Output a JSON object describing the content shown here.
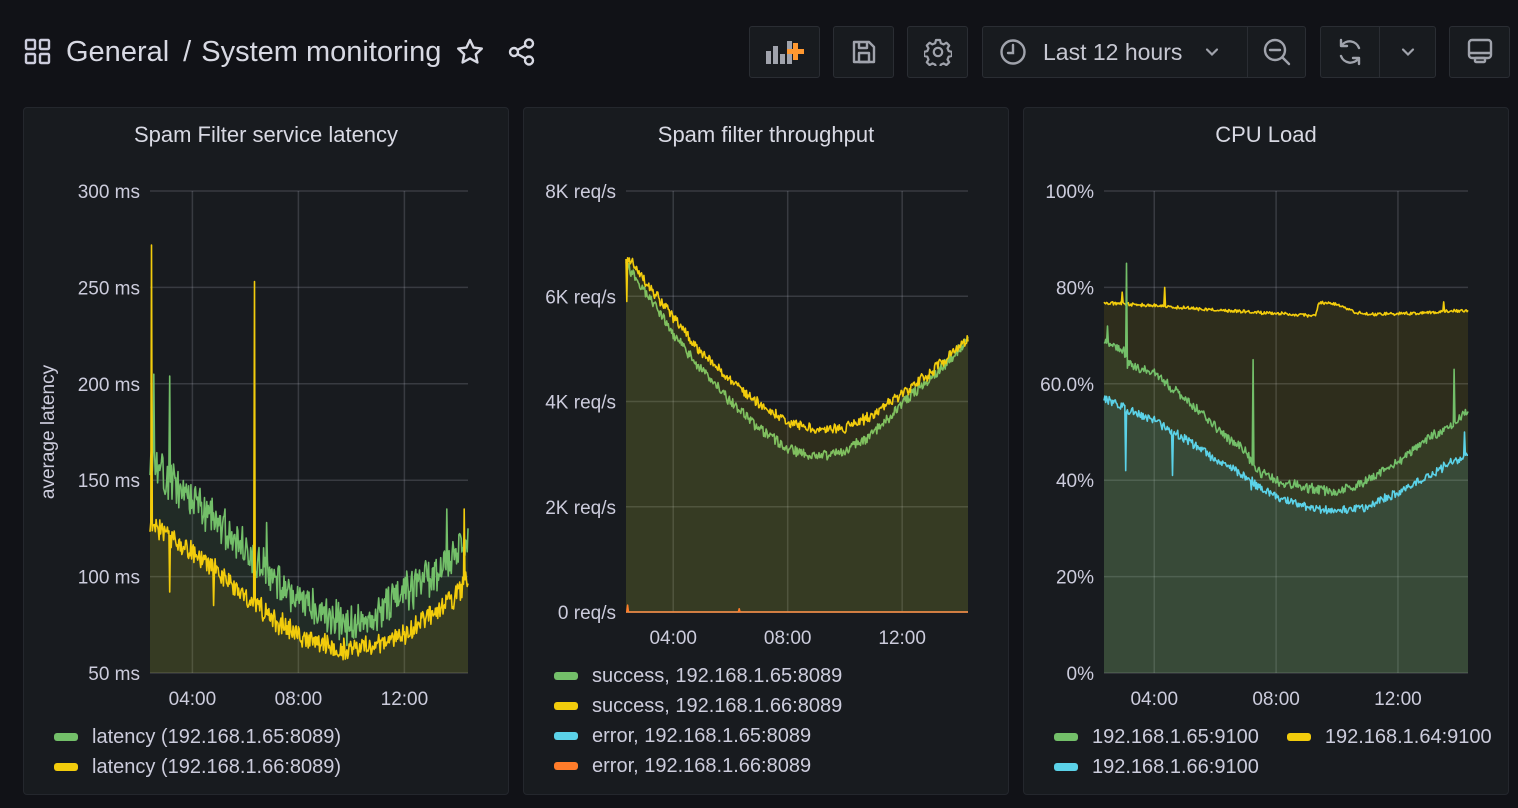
{
  "header": {
    "breadcrumb_root": "General",
    "breadcrumb_separator": "/",
    "dashboard_title": "System monitoring",
    "icons": [
      "dashboard-grid-icon",
      "star-icon",
      "share-icon"
    ]
  },
  "toolbar": {
    "add_panel_icon": "add-panel-icon",
    "save_icon": "save-icon",
    "settings_icon": "gear-icon",
    "time_range_label": "Last 12 hours",
    "time_icon": "clock-icon",
    "zoom_out_icon": "zoom-out-icon",
    "refresh_icon": "refresh-icon",
    "refresh_dropdown_icon": "chevron-down-icon",
    "view_mode_icon": "monitor-icon",
    "accent_color": "#ff9830"
  },
  "colors": {
    "green": "#73bf69",
    "yellow": "#f2cc0c",
    "blue": "#5bd2e8",
    "orange": "#ff7c2a",
    "background": "#111217",
    "panel": "#181b1f"
  },
  "panels": [
    {
      "title": "Spam Filter service latency",
      "legend": [
        {
          "label": "latency (192.168.1.65:8089)",
          "color": "#73bf69"
        },
        {
          "label": "latency (192.168.1.66:8089)",
          "color": "#f2cc0c"
        }
      ]
    },
    {
      "title": "Spam filter throughput",
      "legend": [
        {
          "label": "success, 192.168.1.65:8089",
          "color": "#73bf69"
        },
        {
          "label": "success, 192.168.1.66:8089",
          "color": "#f2cc0c"
        },
        {
          "label": "error, 192.168.1.65:8089",
          "color": "#5bd2e8"
        },
        {
          "label": "error, 192.168.1.66:8089",
          "color": "#ff7c2a"
        }
      ]
    },
    {
      "title": "CPU Load",
      "legend": [
        {
          "label": "192.168.1.65:9100",
          "color": "#73bf69"
        },
        {
          "label": "192.168.1.64:9100",
          "color": "#f2cc0c"
        },
        {
          "label": "192.168.1.66:9100",
          "color": "#5bd2e8"
        }
      ]
    }
  ],
  "chart_data": [
    {
      "type": "area",
      "title": "Spam Filter service latency",
      "xlabel": "",
      "ylabel": "average latency",
      "x_range_hours": [
        2.4,
        14.4
      ],
      "x_ticks": [
        {
          "value": 4,
          "label": "04:00"
        },
        {
          "value": 8,
          "label": "08:00"
        },
        {
          "value": 12,
          "label": "12:00"
        }
      ],
      "ylim": [
        50,
        300
      ],
      "y_ticks": [
        {
          "value": 50,
          "label": "50 ms"
        },
        {
          "value": 100,
          "label": "100 ms"
        },
        {
          "value": 150,
          "label": "150 ms"
        },
        {
          "value": 200,
          "label": "200 ms"
        },
        {
          "value": 250,
          "label": "250 ms"
        },
        {
          "value": 300,
          "label": "300 ms"
        }
      ],
      "grid": true,
      "legend_position": "bottom",
      "series": [
        {
          "name": "latency (192.168.1.65:8089)",
          "color": "#73bf69",
          "noise": 9,
          "seed": 11,
          "x": [
            2.4,
            3.0,
            4.0,
            5.0,
            6.0,
            7.0,
            8.0,
            9.0,
            10.0,
            11.0,
            12.0,
            13.0,
            14.0,
            14.4
          ],
          "values": [
            160,
            150,
            140,
            128,
            115,
            100,
            88,
            80,
            74,
            80,
            92,
            100,
            112,
            120
          ],
          "spikes": [
            {
              "x": 2.55,
              "value": 205
            },
            {
              "x": 3.15,
              "value": 204
            },
            {
              "x": 6.8,
              "value": 128
            },
            {
              "x": 13.6,
              "value": 135
            }
          ]
        },
        {
          "name": "latency (192.168.1.66:8089)",
          "color": "#f2cc0c",
          "noise": 5,
          "seed": 23,
          "x": [
            2.4,
            3.0,
            4.0,
            5.0,
            6.0,
            7.0,
            8.0,
            9.0,
            10.0,
            11.0,
            12.0,
            13.0,
            14.0,
            14.4
          ],
          "values": [
            128,
            122,
            113,
            102,
            90,
            78,
            70,
            65,
            62,
            64,
            70,
            80,
            90,
            100
          ],
          "spikes": [
            {
              "x": 2.45,
              "value": 272
            },
            {
              "x": 6.35,
              "value": 253
            },
            {
              "x": 3.15,
              "value": 92
            },
            {
              "x": 4.8,
              "value": 85
            },
            {
              "x": 14.25,
              "value": 135
            }
          ]
        }
      ]
    },
    {
      "type": "area",
      "title": "Spam filter throughput",
      "xlabel": "",
      "ylabel": "",
      "x_range_hours": [
        2.35,
        14.3
      ],
      "x_ticks": [
        {
          "value": 4,
          "label": "04:00"
        },
        {
          "value": 8,
          "label": "08:00"
        },
        {
          "value": 12,
          "label": "12:00"
        }
      ],
      "ylim": [
        0,
        8000
      ],
      "y_ticks": [
        {
          "value": 0,
          "label": "0 req/s"
        },
        {
          "value": 2000,
          "label": "2K req/s"
        },
        {
          "value": 4000,
          "label": "4K req/s"
        },
        {
          "value": 6000,
          "label": "6K req/s"
        },
        {
          "value": 8000,
          "label": "8K req/s"
        }
      ],
      "grid": true,
      "legend_position": "bottom",
      "series": [
        {
          "name": "success, 192.168.1.65:8089",
          "color": "#73bf69",
          "noise": 90,
          "seed": 5,
          "x": [
            2.35,
            3.0,
            4.0,
            5.0,
            6.0,
            7.0,
            8.0,
            9.0,
            10.0,
            11.0,
            12.0,
            13.0,
            14.3
          ],
          "values": [
            6600,
            6100,
            5300,
            4600,
            4000,
            3500,
            3100,
            2950,
            3050,
            3400,
            3950,
            4450,
            5150
          ],
          "spikes": []
        },
        {
          "name": "success, 192.168.1.66:8089",
          "color": "#f2cc0c",
          "noise": 90,
          "seed": 9,
          "x": [
            2.35,
            3.0,
            4.0,
            5.0,
            6.0,
            7.0,
            8.0,
            9.0,
            10.0,
            11.0,
            12.0,
            13.0,
            14.3
          ],
          "values": [
            6800,
            6300,
            5600,
            4900,
            4400,
            3950,
            3600,
            3450,
            3500,
            3750,
            4150,
            4550,
            5200
          ],
          "spikes": [
            {
              "x": 2.38,
              "value": 5900
            }
          ]
        },
        {
          "name": "error, 192.168.1.65:8089",
          "color": "#5bd2e8",
          "noise": 0,
          "seed": 1,
          "x": [
            2.35,
            14.3
          ],
          "values": [
            0,
            0
          ],
          "spikes": []
        },
        {
          "name": "error, 192.168.1.66:8089",
          "color": "#ff7c2a",
          "noise": 0,
          "seed": 2,
          "x": [
            2.35,
            14.3
          ],
          "values": [
            0,
            0
          ],
          "spikes": [
            {
              "x": 2.4,
              "value": 130
            },
            {
              "x": 6.3,
              "value": 60
            }
          ]
        }
      ]
    },
    {
      "type": "area",
      "title": "CPU Load",
      "xlabel": "",
      "ylabel": "",
      "x_range_hours": [
        2.35,
        14.3
      ],
      "x_ticks": [
        {
          "value": 4,
          "label": "04:00"
        },
        {
          "value": 8,
          "label": "08:00"
        },
        {
          "value": 12,
          "label": "12:00"
        }
      ],
      "ylim": [
        0,
        100
      ],
      "y_ticks": [
        {
          "value": 0,
          "label": "0%"
        },
        {
          "value": 20,
          "label": "20%"
        },
        {
          "value": 40,
          "label": "40%"
        },
        {
          "value": 60,
          "label": "60.0%"
        },
        {
          "value": 80,
          "label": "80%"
        },
        {
          "value": 100,
          "label": "100%"
        }
      ],
      "grid": true,
      "legend_position": "bottom",
      "series": [
        {
          "name": "192.168.1.64:9100",
          "color": "#f2cc0c",
          "noise": 0.3,
          "seed": 31,
          "x": [
            2.35,
            4.0,
            6.0,
            8.0,
            9.3,
            9.4,
            10.0,
            10.6,
            11.0,
            12.0,
            14.3
          ],
          "values": [
            76.8,
            76.2,
            75.3,
            74.6,
            74.1,
            76.8,
            76.5,
            74.8,
            74.5,
            74.5,
            75.2
          ],
          "spikes": [
            {
              "x": 2.95,
              "value": 79
            },
            {
              "x": 4.35,
              "value": 80
            },
            {
              "x": 13.5,
              "value": 77
            }
          ]
        },
        {
          "name": "192.168.1.65:9100",
          "color": "#73bf69",
          "noise": 0.9,
          "seed": 41,
          "x": [
            2.35,
            3.0,
            3.1,
            4.0,
            5.0,
            6.0,
            7.0,
            7.3,
            8.0,
            9.0,
            10.0,
            11.0,
            12.0,
            13.0,
            14.3
          ],
          "values": [
            69,
            67,
            64,
            62,
            57,
            51,
            46,
            42,
            40,
            38.5,
            37.5,
            40,
            44,
            48.5,
            54
          ],
          "spikes": [
            {
              "x": 2.45,
              "value": 72
            },
            {
              "x": 3.08,
              "value": 85
            },
            {
              "x": 7.25,
              "value": 65
            },
            {
              "x": 13.85,
              "value": 63
            }
          ]
        },
        {
          "name": "192.168.1.66:9100",
          "color": "#5bd2e8",
          "noise": 0.8,
          "seed": 53,
          "x": [
            2.35,
            3.0,
            4.0,
            5.0,
            6.0,
            7.0,
            8.0,
            9.0,
            10.0,
            11.0,
            12.0,
            13.0,
            14.3
          ],
          "values": [
            57,
            55,
            52.5,
            48.5,
            44.5,
            40.5,
            36.5,
            34.5,
            33.5,
            34.5,
            37.5,
            41,
            45.5
          ],
          "spikes": [
            {
              "x": 3.05,
              "value": 42
            },
            {
              "x": 4.6,
              "value": 41
            },
            {
              "x": 7.2,
              "value": 38
            },
            {
              "x": 14.2,
              "value": 50
            }
          ]
        }
      ]
    }
  ]
}
